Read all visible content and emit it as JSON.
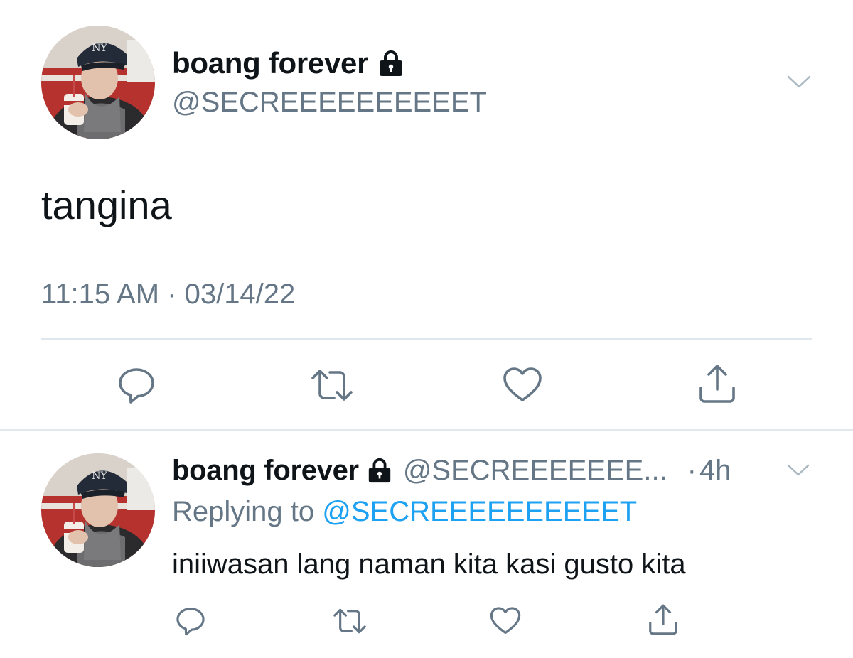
{
  "main_tweet": {
    "display_name": "boang forever",
    "handle": "@SECREEEEEEEEEET",
    "text": "tangina",
    "timestamp": "11:15 AM · 03/14/22",
    "protected_icon": "lock-icon",
    "menu_icon": "chevron-down-icon",
    "actions": [
      "reply-icon",
      "retweet-icon",
      "like-icon",
      "share-icon"
    ]
  },
  "reply_tweet": {
    "display_name": "boang forever",
    "handle": "@SECREEEEEEE...",
    "dot": "·",
    "time": "4h",
    "replying_label": "Replying to ",
    "replying_handle": "@SECREEEEEEEEEET",
    "text": "iniiwasan lang naman kita kasi gusto kita",
    "protected_icon": "lock-icon",
    "menu_icon": "chevron-down-icon",
    "actions": [
      "reply-icon",
      "retweet-icon",
      "like-icon",
      "share-icon"
    ]
  },
  "colors": {
    "text_primary": "#0f1419",
    "text_secondary": "#657786",
    "link": "#1da1f2",
    "icon": "#657786",
    "divider": "#e1e8ed"
  }
}
